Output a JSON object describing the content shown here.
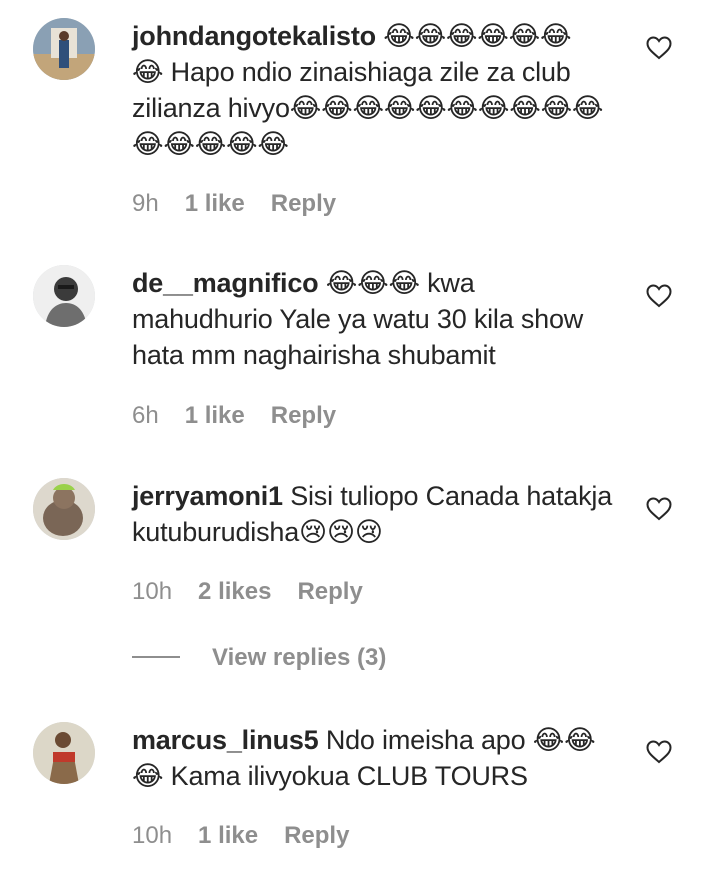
{
  "comments": [
    {
      "username": "johndangotekalisto",
      "text_before": " 😂😂😂😂😂😂",
      "text": "😂 Hapo ndio zinaishiaga zile za club zilianza hivyo😂😂😂😂😂😂😂😂😂😂😂😂😂😂😂",
      "time": "9h",
      "likes": "1 like",
      "reply": "Reply",
      "avatar_colors": [
        "#6b7c8f",
        "#b9a07a",
        "#3d5f8a"
      ]
    },
    {
      "username": "de__magnifico",
      "text_before": "",
      "text": "😂😂😂 kwa mahudhurio Yale ya watu 30 kila show hata mm naghairisha shubamit",
      "time": "6h",
      "likes": "1 like",
      "reply": "Reply",
      "avatar_colors": [
        "#e6e6e6",
        "#3a3a3a",
        "#9a9a9a"
      ]
    },
    {
      "username": "jerryamoni1",
      "text_before": "",
      "text": "Sisi tuliopo Canada hatakja kutuburudisha😢😢😢",
      "time": "10h",
      "likes": "2 likes",
      "reply": "Reply",
      "avatar_colors": [
        "#d7d2c8",
        "#6b5a4a",
        "#9ad14a"
      ]
    },
    {
      "username": "marcus_linus5",
      "text_before": "",
      "text": "Ndo imeisha apo 😂😂 😂 Kama ilivyokua CLUB TOURS",
      "time": "10h",
      "likes": "1 like",
      "reply": "Reply",
      "avatar_colors": [
        "#d9d4c4",
        "#7a5a3c",
        "#c0392b"
      ]
    }
  ],
  "view_replies": "View replies (3)",
  "colors": {
    "text": "#262626",
    "secondary": "#8e8e8e",
    "background": "#ffffff"
  }
}
